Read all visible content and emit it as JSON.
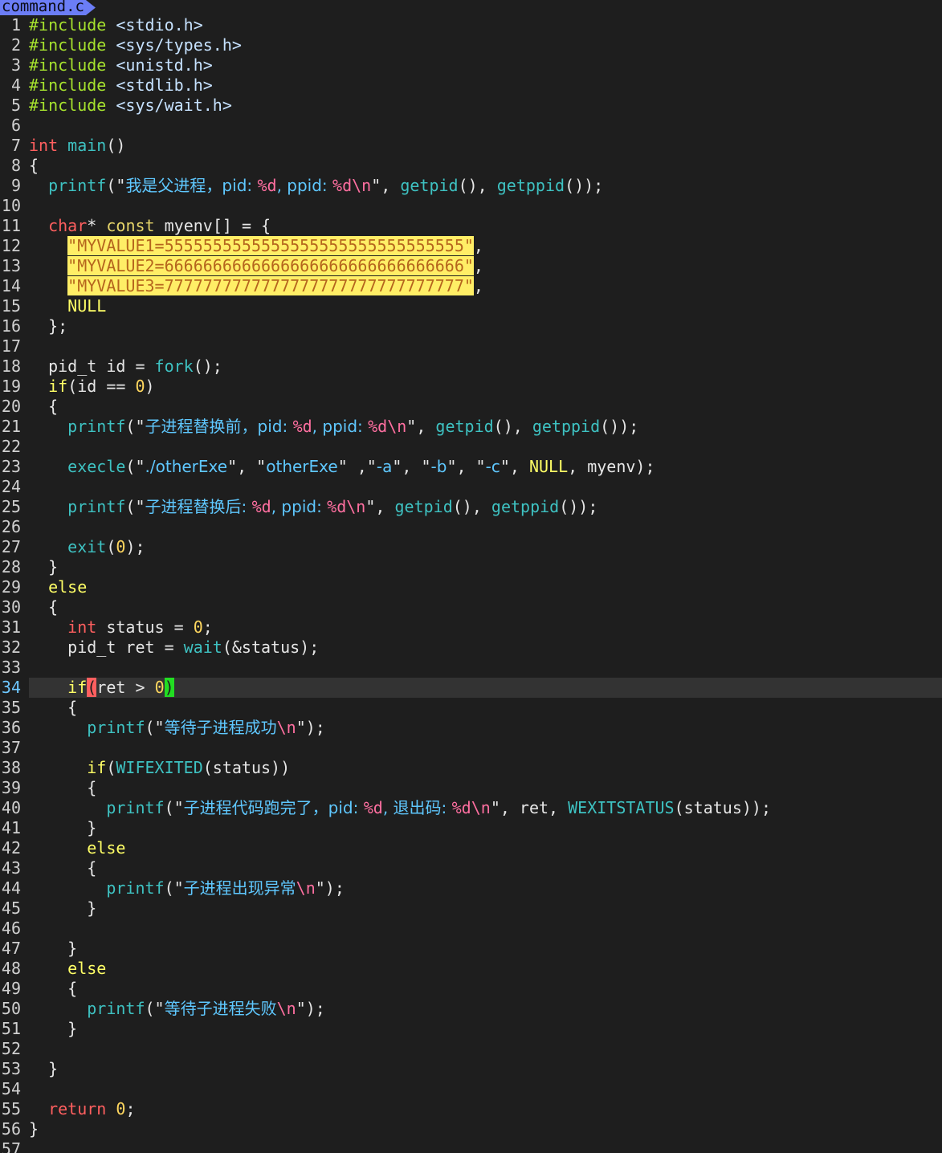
{
  "tab": {
    "filename": "command.c"
  },
  "cursor_line": 34,
  "lines": [
    [
      {
        "t": "#include ",
        "c": "t-pre"
      },
      {
        "t": "<stdio.h>",
        "c": "t-inc"
      }
    ],
    [
      {
        "t": "#include ",
        "c": "t-pre"
      },
      {
        "t": "<sys/types.h>",
        "c": "t-inc"
      }
    ],
    [
      {
        "t": "#include ",
        "c": "t-pre"
      },
      {
        "t": "<unistd.h>",
        "c": "t-inc"
      }
    ],
    [
      {
        "t": "#include ",
        "c": "t-pre"
      },
      {
        "t": "<stdlib.h>",
        "c": "t-inc"
      }
    ],
    [
      {
        "t": "#include ",
        "c": "t-pre"
      },
      {
        "t": "<sys/wait.h>",
        "c": "t-inc"
      }
    ],
    [],
    [
      {
        "t": "int",
        "c": "t-type"
      },
      {
        "t": " ",
        "c": "t-plain"
      },
      {
        "t": "main",
        "c": "t-fn"
      },
      {
        "t": "()",
        "c": "t-plain"
      }
    ],
    [
      {
        "t": "{",
        "c": "t-plain"
      }
    ],
    [
      {
        "t": "  ",
        "c": "t-plain"
      },
      {
        "t": "printf",
        "c": "t-fn"
      },
      {
        "t": "(\"",
        "c": "t-plain"
      },
      {
        "t": "我是父进程，pid: ",
        "c": "t-cjk"
      },
      {
        "t": "%d",
        "c": "t-fmt"
      },
      {
        "t": ", ppid: ",
        "c": "t-cjk"
      },
      {
        "t": "%d",
        "c": "t-fmt"
      },
      {
        "t": "\\n",
        "c": "t-esc"
      },
      {
        "t": "\", ",
        "c": "t-plain"
      },
      {
        "t": "getpid",
        "c": "t-fn"
      },
      {
        "t": "(), ",
        "c": "t-plain"
      },
      {
        "t": "getppid",
        "c": "t-fn"
      },
      {
        "t": "());",
        "c": "t-plain"
      }
    ],
    [],
    [
      {
        "t": "  ",
        "c": "t-plain"
      },
      {
        "t": "char",
        "c": "t-type"
      },
      {
        "t": "* ",
        "c": "t-plain"
      },
      {
        "t": "const",
        "c": "t-str"
      },
      {
        "t": " myenv[] = {",
        "c": "t-plain"
      }
    ],
    [
      {
        "t": "    ",
        "c": "t-plain"
      },
      {
        "t": "\"MYVALUE1=5555555555555555555555555555555\"",
        "c": "hl-yellow"
      },
      {
        "t": ",",
        "c": "t-plain"
      }
    ],
    [
      {
        "t": "    ",
        "c": "t-plain"
      },
      {
        "t": "\"MYVALUE2=6666666666666666666666666666666\"",
        "c": "hl-yellow"
      },
      {
        "t": ",",
        "c": "t-plain"
      }
    ],
    [
      {
        "t": "    ",
        "c": "t-plain"
      },
      {
        "t": "\"MYVALUE3=7777777777777777777777777777777\"",
        "c": "hl-yellow"
      },
      {
        "t": ",",
        "c": "t-plain"
      }
    ],
    [
      {
        "t": "    ",
        "c": "t-plain"
      },
      {
        "t": "NULL",
        "c": "t-kw"
      }
    ],
    [
      {
        "t": "  };",
        "c": "t-plain"
      }
    ],
    [],
    [
      {
        "t": "  pid_t id = ",
        "c": "t-plain"
      },
      {
        "t": "fork",
        "c": "t-fn"
      },
      {
        "t": "();",
        "c": "t-plain"
      }
    ],
    [
      {
        "t": "  ",
        "c": "t-plain"
      },
      {
        "t": "if",
        "c": "t-kw"
      },
      {
        "t": "(id == ",
        "c": "t-plain"
      },
      {
        "t": "0",
        "c": "t-num"
      },
      {
        "t": ")",
        "c": "t-plain"
      }
    ],
    [
      {
        "t": "  {",
        "c": "t-plain"
      }
    ],
    [
      {
        "t": "    ",
        "c": "t-plain"
      },
      {
        "t": "printf",
        "c": "t-fn"
      },
      {
        "t": "(\"",
        "c": "t-plain"
      },
      {
        "t": "子进程替换前，pid: ",
        "c": "t-cjk"
      },
      {
        "t": "%d",
        "c": "t-fmt"
      },
      {
        "t": ", ppid: ",
        "c": "t-cjk"
      },
      {
        "t": "%d",
        "c": "t-fmt"
      },
      {
        "t": "\\n",
        "c": "t-esc"
      },
      {
        "t": "\", ",
        "c": "t-plain"
      },
      {
        "t": "getpid",
        "c": "t-fn"
      },
      {
        "t": "(), ",
        "c": "t-plain"
      },
      {
        "t": "getppid",
        "c": "t-fn"
      },
      {
        "t": "());",
        "c": "t-plain"
      }
    ],
    [],
    [
      {
        "t": "    ",
        "c": "t-plain"
      },
      {
        "t": "execle",
        "c": "t-fn"
      },
      {
        "t": "(\"",
        "c": "t-plain"
      },
      {
        "t": "./otherExe",
        "c": "t-cjk"
      },
      {
        "t": "\", \"",
        "c": "t-plain"
      },
      {
        "t": "otherExe",
        "c": "t-cjk"
      },
      {
        "t": "\" ,\"",
        "c": "t-plain"
      },
      {
        "t": "-a",
        "c": "t-cjk"
      },
      {
        "t": "\", \"",
        "c": "t-plain"
      },
      {
        "t": "-b",
        "c": "t-cjk"
      },
      {
        "t": "\", \"",
        "c": "t-plain"
      },
      {
        "t": "-c",
        "c": "t-cjk"
      },
      {
        "t": "\", ",
        "c": "t-plain"
      },
      {
        "t": "NULL",
        "c": "t-kw"
      },
      {
        "t": ", myenv);",
        "c": "t-plain"
      }
    ],
    [],
    [
      {
        "t": "    ",
        "c": "t-plain"
      },
      {
        "t": "printf",
        "c": "t-fn"
      },
      {
        "t": "(\"",
        "c": "t-plain"
      },
      {
        "t": "子进程替换后: ",
        "c": "t-cjk"
      },
      {
        "t": "%d",
        "c": "t-fmt"
      },
      {
        "t": ", ppid: ",
        "c": "t-cjk"
      },
      {
        "t": "%d",
        "c": "t-fmt"
      },
      {
        "t": "\\n",
        "c": "t-esc"
      },
      {
        "t": "\", ",
        "c": "t-plain"
      },
      {
        "t": "getpid",
        "c": "t-fn"
      },
      {
        "t": "(), ",
        "c": "t-plain"
      },
      {
        "t": "getppid",
        "c": "t-fn"
      },
      {
        "t": "());",
        "c": "t-plain"
      }
    ],
    [],
    [
      {
        "t": "    ",
        "c": "t-plain"
      },
      {
        "t": "exit",
        "c": "t-fn"
      },
      {
        "t": "(",
        "c": "t-plain"
      },
      {
        "t": "0",
        "c": "t-num"
      },
      {
        "t": ");",
        "c": "t-plain"
      }
    ],
    [
      {
        "t": "  }",
        "c": "t-plain"
      }
    ],
    [
      {
        "t": "  ",
        "c": "t-plain"
      },
      {
        "t": "else",
        "c": "t-kw"
      }
    ],
    [
      {
        "t": "  {",
        "c": "t-plain"
      }
    ],
    [
      {
        "t": "    ",
        "c": "t-plain"
      },
      {
        "t": "int",
        "c": "t-type"
      },
      {
        "t": " status = ",
        "c": "t-plain"
      },
      {
        "t": "0",
        "c": "t-num"
      },
      {
        "t": ";",
        "c": "t-plain"
      }
    ],
    [
      {
        "t": "    pid_t ret = ",
        "c": "t-plain"
      },
      {
        "t": "wait",
        "c": "t-fn"
      },
      {
        "t": "(&status);",
        "c": "t-plain"
      }
    ],
    [],
    [
      {
        "t": "    ",
        "c": "t-plain"
      },
      {
        "t": "if",
        "c": "t-kw"
      },
      {
        "t": "(",
        "c": "hl-red"
      },
      {
        "t": "ret > ",
        "c": "t-plain"
      },
      {
        "t": "0",
        "c": "t-num"
      },
      {
        "t": ")",
        "c": "hl-green"
      }
    ],
    [
      {
        "t": "    {",
        "c": "t-plain"
      }
    ],
    [
      {
        "t": "      ",
        "c": "t-plain"
      },
      {
        "t": "printf",
        "c": "t-fn"
      },
      {
        "t": "(\"",
        "c": "t-plain"
      },
      {
        "t": "等待子进程成功",
        "c": "t-cjk"
      },
      {
        "t": "\\n",
        "c": "t-esc"
      },
      {
        "t": "\");",
        "c": "t-plain"
      }
    ],
    [],
    [
      {
        "t": "      ",
        "c": "t-plain"
      },
      {
        "t": "if",
        "c": "t-kw"
      },
      {
        "t": "(",
        "c": "t-plain"
      },
      {
        "t": "WIFEXITED",
        "c": "t-fn"
      },
      {
        "t": "(status))",
        "c": "t-plain"
      }
    ],
    [
      {
        "t": "      {",
        "c": "t-plain"
      }
    ],
    [
      {
        "t": "        ",
        "c": "t-plain"
      },
      {
        "t": "printf",
        "c": "t-fn"
      },
      {
        "t": "(\"",
        "c": "t-plain"
      },
      {
        "t": "子进程代码跑完了，pid: ",
        "c": "t-cjk"
      },
      {
        "t": "%d",
        "c": "t-fmt"
      },
      {
        "t": ", 退出码: ",
        "c": "t-cjk"
      },
      {
        "t": "%d",
        "c": "t-fmt"
      },
      {
        "t": "\\n",
        "c": "t-esc"
      },
      {
        "t": "\", ret, ",
        "c": "t-plain"
      },
      {
        "t": "WEXITSTATUS",
        "c": "t-fn"
      },
      {
        "t": "(status));",
        "c": "t-plain"
      }
    ],
    [
      {
        "t": "      }",
        "c": "t-plain"
      }
    ],
    [
      {
        "t": "      ",
        "c": "t-plain"
      },
      {
        "t": "else",
        "c": "t-kw"
      }
    ],
    [
      {
        "t": "      {",
        "c": "t-plain"
      }
    ],
    [
      {
        "t": "        ",
        "c": "t-plain"
      },
      {
        "t": "printf",
        "c": "t-fn"
      },
      {
        "t": "(\"",
        "c": "t-plain"
      },
      {
        "t": "子进程出现异常",
        "c": "t-cjk"
      },
      {
        "t": "\\n",
        "c": "t-esc"
      },
      {
        "t": "\");",
        "c": "t-plain"
      }
    ],
    [
      {
        "t": "      }",
        "c": "t-plain"
      }
    ],
    [],
    [
      {
        "t": "    }",
        "c": "t-plain"
      }
    ],
    [
      {
        "t": "    ",
        "c": "t-plain"
      },
      {
        "t": "else",
        "c": "t-kw"
      }
    ],
    [
      {
        "t": "    {",
        "c": "t-plain"
      }
    ],
    [
      {
        "t": "      ",
        "c": "t-plain"
      },
      {
        "t": "printf",
        "c": "t-fn"
      },
      {
        "t": "(\"",
        "c": "t-plain"
      },
      {
        "t": "等待子进程失败",
        "c": "t-cjk"
      },
      {
        "t": "\\n",
        "c": "t-esc"
      },
      {
        "t": "\");",
        "c": "t-plain"
      }
    ],
    [
      {
        "t": "    }",
        "c": "t-plain"
      }
    ],
    [],
    [
      {
        "t": "  }",
        "c": "t-plain"
      }
    ],
    [],
    [
      {
        "t": "  ",
        "c": "t-plain"
      },
      {
        "t": "return",
        "c": "t-type"
      },
      {
        "t": " ",
        "c": "t-plain"
      },
      {
        "t": "0",
        "c": "t-num"
      },
      {
        "t": ";",
        "c": "t-plain"
      }
    ],
    [
      {
        "t": "}",
        "c": "t-plain"
      }
    ],
    []
  ]
}
